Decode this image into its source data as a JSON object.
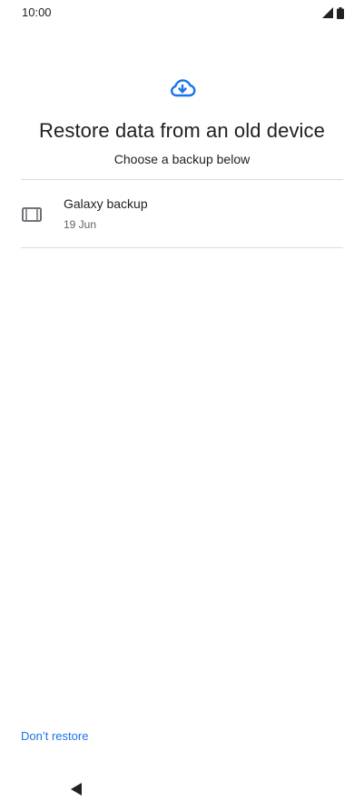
{
  "status_bar": {
    "time": "10:00",
    "icons": [
      "signal-icon",
      "battery-icon"
    ]
  },
  "header": {
    "icon": "cloud-download-icon",
    "title": "Restore data from an old device",
    "subtitle": "Choose a backup below"
  },
  "backups": [
    {
      "icon": "tablet-icon",
      "name": "Galaxy backup",
      "date": "19 Jun"
    }
  ],
  "footer": {
    "dont_restore_label": "Don’t restore"
  },
  "nav": {
    "back_icon": "back-triangle-icon"
  },
  "colors": {
    "accent": "#1a73e8",
    "text_primary": "#202124",
    "text_secondary": "#5f6368",
    "divider": "#dadce0"
  }
}
